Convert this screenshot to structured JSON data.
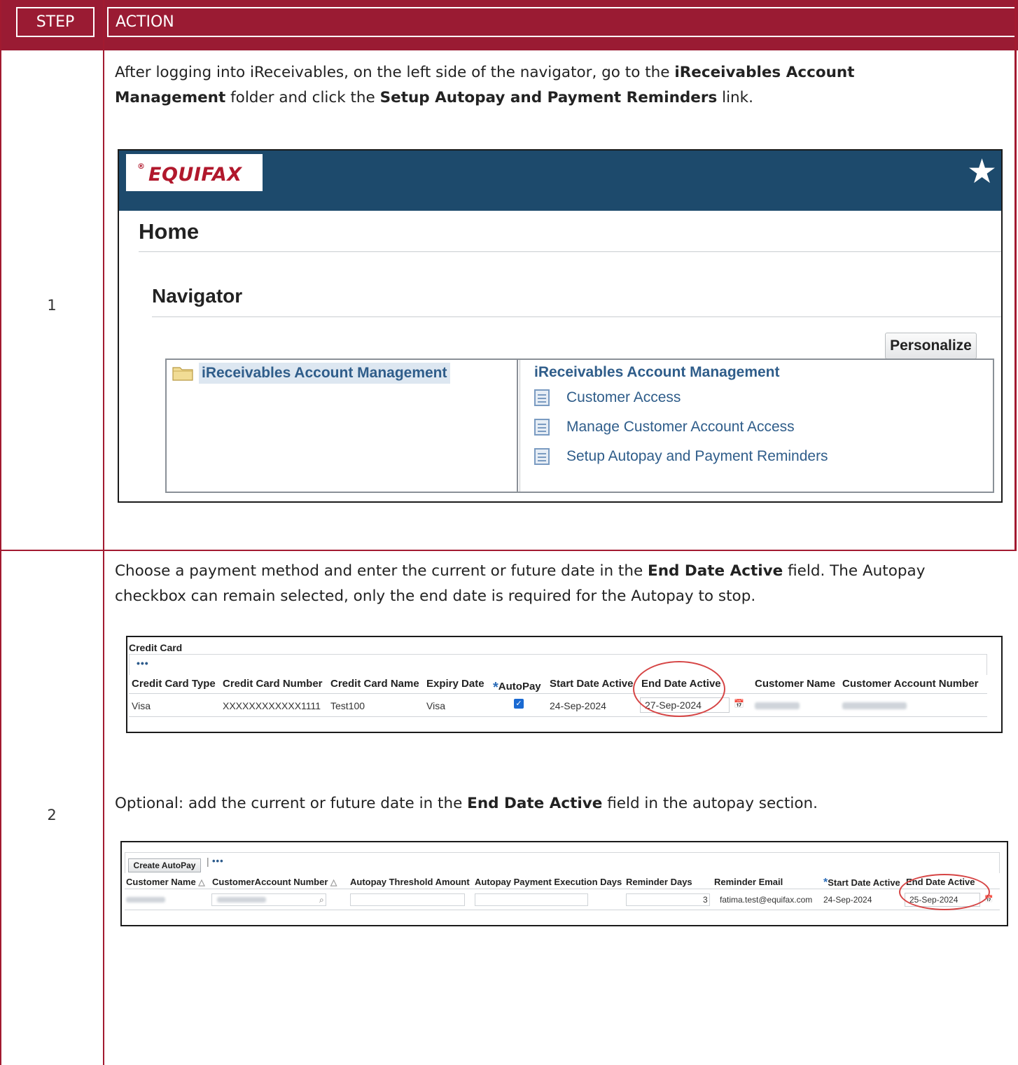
{
  "header": {
    "step_label": "STEP",
    "action_label": "ACTION"
  },
  "steps": [
    {
      "number": "1",
      "instruction": {
        "t1": "After logging into iReceivables, on the left side of the navigator, go to the ",
        "b1": "iReceivables Account Management",
        "t2": " folder and click the ",
        "b2": "Setup Autopay and Payment Reminders",
        "t3": " link."
      }
    },
    {
      "number": "2",
      "instruction": {
        "t1": "Choose a payment method and enter the current or future date in the ",
        "b1": "End Date Active",
        "t2": " field. The Autopay checkbox can remain selected, only the end date is required for the Autopay to stop."
      },
      "optional": {
        "t1": "Optional: add the current or future date in the ",
        "b1": "End Date Active",
        "t2": " field in the autopay section."
      }
    }
  ],
  "navigator_screenshot": {
    "logo": "EQUIFAX",
    "logo_mark": "®",
    "home_title": "Home",
    "navigator_title": "Navigator",
    "personalize_label": "Personalize",
    "folder_label": "iReceivables Account Management",
    "right_title": "iReceivables Account Management",
    "links": [
      "Customer Access",
      "Manage Customer Account Access",
      "Setup Autopay and Payment Reminders"
    ]
  },
  "credit_card_screenshot": {
    "title": "Credit Card",
    "toolbar_more": "•••",
    "columns": [
      "Credit Card Type",
      "Credit Card Number",
      "Credit Card Name",
      "Expiry Date",
      "AutoPay",
      "Start Date Active",
      "End Date Active",
      "Customer Name",
      "Customer Account Number"
    ],
    "row": {
      "type": "Visa",
      "number": "XXXXXXXXXXXX1111",
      "name": "Test100",
      "expiry": "Visa",
      "autopay_checked": true,
      "start_date": "24-Sep-2024",
      "end_date": "27-Sep-2024"
    }
  },
  "autopay_screenshot": {
    "create_button": "Create AutoPay",
    "toolbar_sep": "|",
    "toolbar_more": "•••",
    "columns": [
      "Customer Name",
      "CustomerAccount Number",
      "Autopay Threshold Amount",
      "Autopay Payment Execution Days",
      "Reminder Days",
      "Reminder Email",
      "Start Date Active",
      "End Date Active"
    ],
    "row": {
      "reminder_days": "3",
      "reminder_email": "fatima.test@equifax.com",
      "start_date": "24-Sep-2024",
      "end_date": "25-Sep-2024"
    }
  },
  "colors": {
    "brand_red": "#9a1b33",
    "equifax_navy": "#1d4a6c",
    "link_blue": "#2f5d8a",
    "highlight_circle": "#d64545"
  }
}
